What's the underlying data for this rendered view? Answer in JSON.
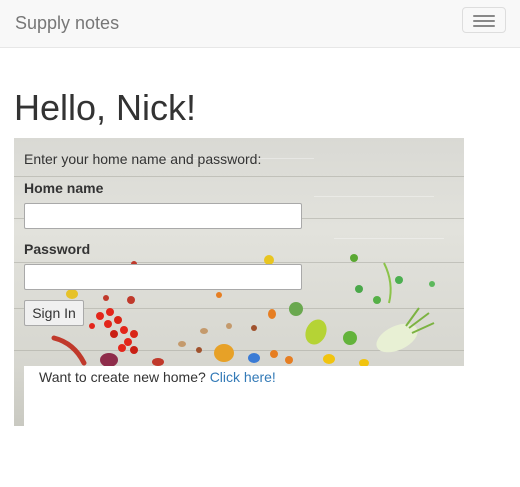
{
  "navbar": {
    "brand": "Supply notes",
    "menu_icon": "hamburger-menu-icon"
  },
  "greeting": "Hello, Nick!",
  "login": {
    "intro": "Enter your home name and password:",
    "home_name_label": "Home name",
    "home_name_value": "",
    "password_label": "Password",
    "password_value": "",
    "submit_label": "Sign In"
  },
  "create_home": {
    "text": "Want to create new home?",
    "link_label": "Click here!"
  },
  "colors": {
    "link": "#337ab7",
    "navbar_bg": "#f8f8f8",
    "text": "#333333"
  }
}
